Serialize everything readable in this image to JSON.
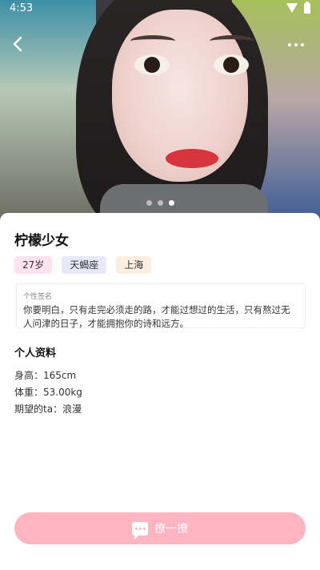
{
  "status_bar": {
    "time": "4:53"
  },
  "gallery": {
    "page_count": 3,
    "current_index": 2
  },
  "profile": {
    "name": "柠檬少女",
    "tags": {
      "age": "27岁",
      "zodiac": "天蝎座",
      "city": "上海"
    },
    "signature": {
      "label": "个性签名",
      "text": "你要明白，只有走完必须走的路，才能过想过的生活，只有熬过无人问津的日子，才能拥抱你的诗和远方。"
    }
  },
  "details": {
    "title": "个人资料",
    "height": "身高：165cm",
    "weight": "体重：53.00kg",
    "ideal": "期望的ta：浪漫"
  },
  "action": {
    "label": "撩一撩"
  },
  "colors": {
    "accent_pink": "#ffb4c2",
    "tag_age_bg": "#fde3ef",
    "tag_zodiac_bg": "#e7e8f8",
    "tag_city_bg": "#fdeee2"
  },
  "icons": [
    "back-arrow-icon",
    "more-dots-icon",
    "wifi-icon",
    "battery-icon",
    "chat-bubble-icon"
  ]
}
